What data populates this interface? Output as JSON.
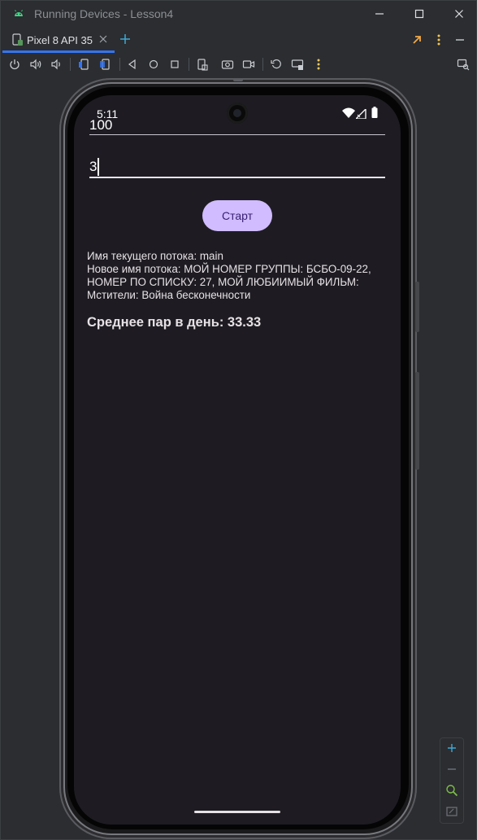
{
  "window": {
    "title": "Running Devices - Lesson4"
  },
  "tabs": [
    {
      "label": "Pixel 8 API 35"
    }
  ],
  "toolbar_icons": [
    "power-icon",
    "volume-up-icon",
    "volume-down-icon",
    "rotate-left-icon",
    "rotate-right-icon",
    "back-icon",
    "home-icon",
    "overview-icon",
    "screenshot-file-icon",
    "camera-icon",
    "screen-record-icon",
    "reset-icon",
    "keyboard-icon",
    "more-icon",
    "mirror-icon"
  ],
  "device": {
    "status_time": "5:11",
    "field1_value": "100",
    "field2_value": "3",
    "start_label": "Старт",
    "thread_info": "Имя текущего потока: main\nНовое имя потока: МОЙ НОМЕР ГРУППЫ: БСБО-09-22, НОМЕР ПО СПИСКУ: 27, МОЙ ЛЮБИИМЫЙ ФИЛЬМ: Мстители: Война бесконечности",
    "average_text": "Среднее пар в день: 33.33"
  },
  "colors": {
    "accent": "#3574f0",
    "button_bg": "#d0bcff",
    "button_text": "#381e72",
    "screen_bg": "#1e1c22",
    "ide_bg": "#2b2d30"
  }
}
